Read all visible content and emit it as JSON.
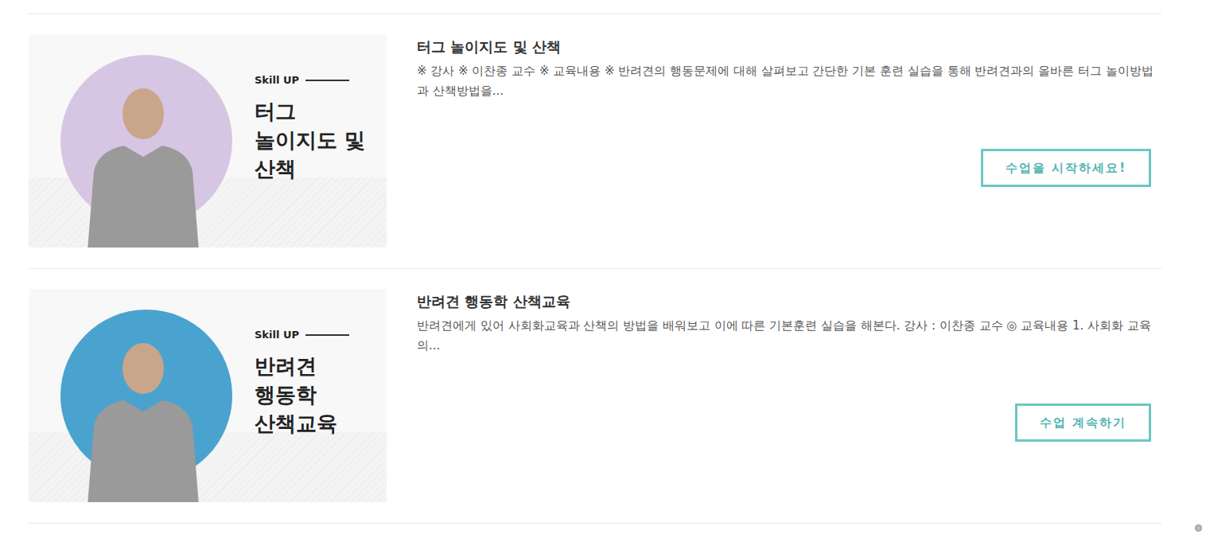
{
  "courses": [
    {
      "thumbnail": {
        "tag": "Skill UP",
        "lines": [
          "터그",
          "놀이지도 및",
          "산책"
        ],
        "color": "#d7c6e3"
      },
      "title": "터그 놀이지도 및 산책",
      "description": "※ 강사 ※ 이찬종 교수   ※ 교육내용 ※ 반려견의 행동문제에 대해 살펴보고 간단한 기본 훈련 실습을 통해 반려견과의 올바른 터그 놀이방법과 산책방법을...",
      "button": "수업을 시작하세요!"
    },
    {
      "thumbnail": {
        "tag": "Skill UP",
        "lines": [
          "반려견",
          "행동학",
          "산책교육"
        ],
        "color": "#4aa3cf"
      },
      "title": "반려견 행동학 산책교육",
      "description": "반려견에게 있어 사회화교육과 산책의 방법을 배워보고 이에 따른 기본훈련 실습을 해본다. 강사 : 이찬종 교수 ◎ 교육내용 1. 사회화 교육의...",
      "button": "수업 계속하기"
    }
  ]
}
